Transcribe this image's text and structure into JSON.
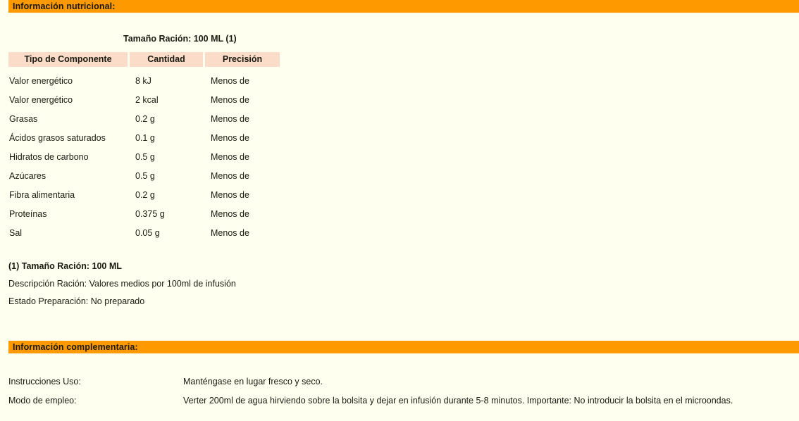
{
  "sections": {
    "nutritional": {
      "banner_label": "Información nutricional:",
      "serving_caption": "Tamaño Ración: 100 ML (1)",
      "table": {
        "headers": {
          "component": "Tipo de Componente",
          "amount": "Cantidad",
          "precision": "Precisión"
        },
        "rows": [
          {
            "component": "Valor energético",
            "amount": "8 kJ",
            "precision": "Menos de"
          },
          {
            "component": "Valor energético",
            "amount": "2 kcal",
            "precision": "Menos de"
          },
          {
            "component": "Grasas",
            "amount": "0.2 g",
            "precision": "Menos de"
          },
          {
            "component": "Ácidos grasos saturados",
            "amount": "0.1 g",
            "precision": "Menos de"
          },
          {
            "component": "Hidratos de carbono",
            "amount": "0.5 g",
            "precision": "Menos de"
          },
          {
            "component": "Azúcares",
            "amount": "0.5 g",
            "precision": "Menos de"
          },
          {
            "component": "Fibra alimentaria",
            "amount": "0.2 g",
            "precision": "Menos de"
          },
          {
            "component": "Proteínas",
            "amount": "0.375 g",
            "precision": "Menos de"
          },
          {
            "component": "Sal",
            "amount": "0.05 g",
            "precision": "Menos de"
          }
        ]
      },
      "footnotes": [
        "(1) Tamaño Ración: 100 ML",
        "Descripción Ración: Valores medios por 100ml de infusión",
        "Estado Preparación: No preparado"
      ]
    },
    "complementary": {
      "banner_label": "Información complementaria:",
      "rows": [
        {
          "label": "Instrucciones Uso:",
          "value": "Manténgase en lugar fresco y seco."
        },
        {
          "label": "Modo de empleo:",
          "value": "Verter 200ml de agua hirviendo sobre la bolsita y dejar en infusión durante 5-8 minutos. Importante: No introducir la bolsita en el microondas."
        }
      ]
    }
  },
  "colors": {
    "banner_background": "#FF9900",
    "page_background": "#FFFFF0",
    "table_header_background": "#FADCC8",
    "text": "#1A1A10"
  }
}
